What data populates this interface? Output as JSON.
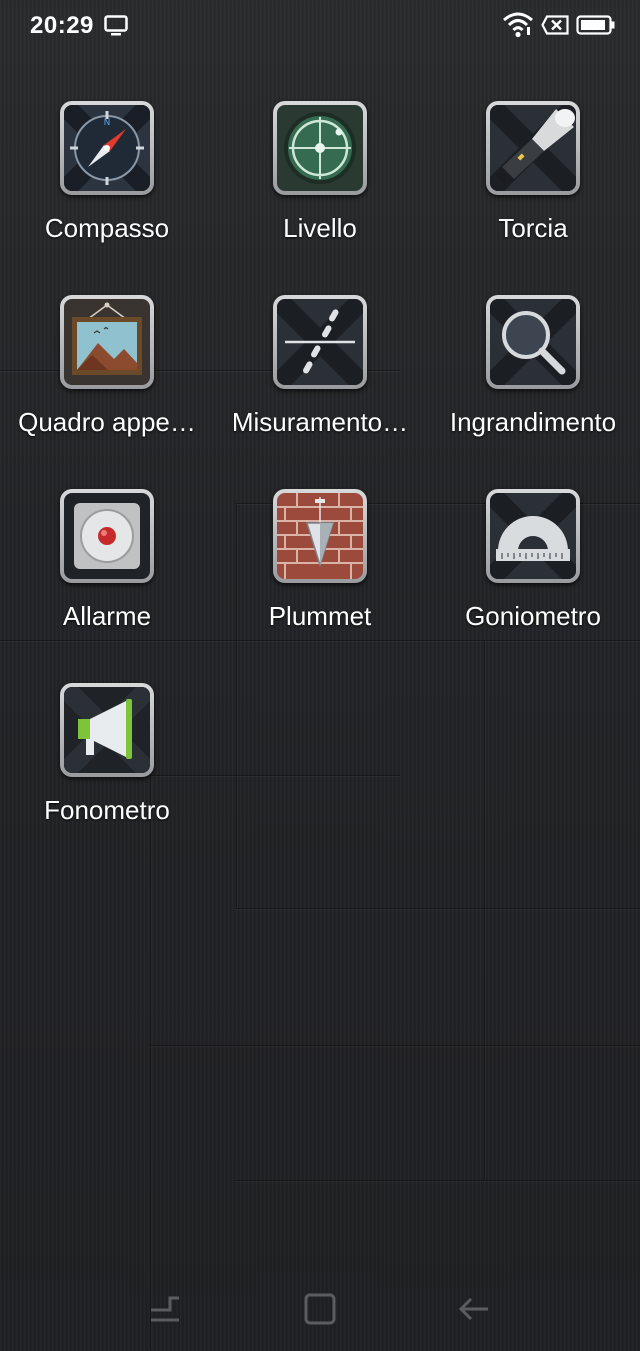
{
  "status_bar": {
    "time": "20:29",
    "icons": [
      "tv-icon",
      "wifi-icon",
      "no-sim-icon",
      "battery-icon"
    ]
  },
  "apps": [
    {
      "label": "Compasso",
      "icon": "compass-icon"
    },
    {
      "label": "Livello",
      "icon": "level-icon"
    },
    {
      "label": "Torcia",
      "icon": "flashlight-icon"
    },
    {
      "label": "Quadro appe…",
      "icon": "picture-frame-icon"
    },
    {
      "label": "Misuramento…",
      "icon": "measure-icon"
    },
    {
      "label": "Ingrandimento",
      "icon": "magnifier-icon"
    },
    {
      "label": "Allarme",
      "icon": "alarm-icon"
    },
    {
      "label": "Plummet",
      "icon": "plumb-bob-icon"
    },
    {
      "label": "Goniometro",
      "icon": "protractor-icon"
    },
    {
      "label": "Fonometro",
      "icon": "megaphone-icon"
    }
  ],
  "nav_bar": {
    "buttons": [
      "recents-button",
      "home-button",
      "back-button"
    ]
  },
  "colors": {
    "background": "#232427",
    "text": "#ffffff",
    "tile_frame": "#c8c9cb"
  }
}
